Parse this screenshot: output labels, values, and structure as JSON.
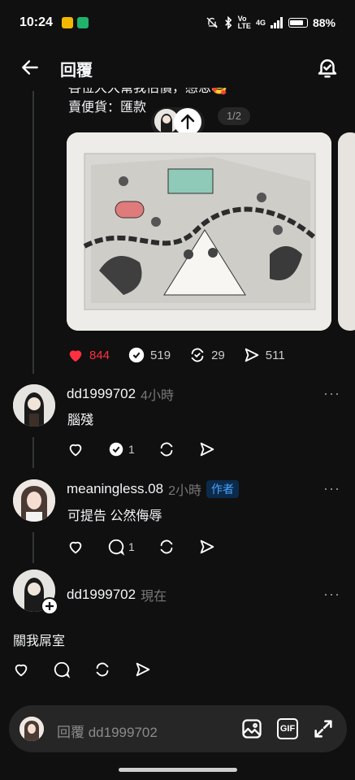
{
  "status_bar": {
    "time": "10:24",
    "battery": "88%",
    "net": "4G"
  },
  "header": {
    "title": "回覆"
  },
  "original_post": {
    "text_line1": "各位大大幫我估價，感恩🥰",
    "text_line2": "賣便貨：匯款",
    "page_indicator": "1/2",
    "likes": "844",
    "comments": "519",
    "reposts": "29",
    "shares": "511"
  },
  "comments": [
    {
      "username": "dd1999702",
      "time": "4小時",
      "text": "腦殘",
      "comment_count": "1"
    },
    {
      "username": "meaningless.08",
      "time": "2小時",
      "badge": "作者",
      "text": "可提告 公然侮辱",
      "comment_count": "1"
    },
    {
      "username": "dd1999702",
      "time": "現在",
      "text": "關我屌室"
    }
  ],
  "reply_bar": {
    "placeholder": "回覆 dd1999702"
  },
  "colors": {
    "background": "#101010",
    "like_red": "#ff3040",
    "badge_blue": "#4aa3ff"
  }
}
